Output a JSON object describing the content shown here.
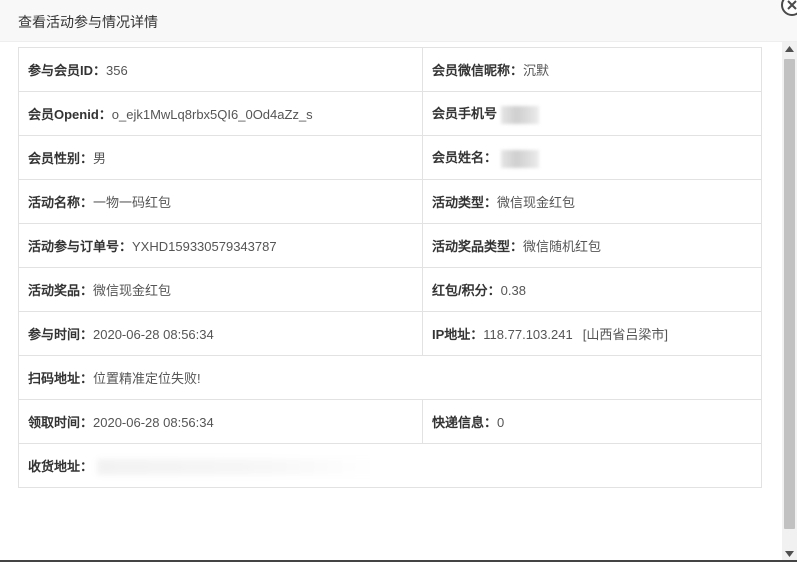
{
  "dialog": {
    "title": "查看活动参与情况详情",
    "close_icon": "close-icon"
  },
  "rows": [
    [
      {
        "label": "参与会员ID：",
        "value": "356"
      },
      {
        "label": "会员微信昵称：",
        "value": "沉默"
      }
    ],
    [
      {
        "label": "会员Openid：",
        "value": "o_ejk1MwLq8rbx5QI6_0Od4aZz_s"
      },
      {
        "label": "会员手机号",
        "value": ""
      }
    ],
    [
      {
        "label": "会员性别：",
        "value": "男"
      },
      {
        "label": "会员姓名：",
        "value": ""
      }
    ],
    [
      {
        "label": "活动名称：",
        "value": "一物一码红包"
      },
      {
        "label": "活动类型：",
        "value": "微信现金红包"
      }
    ],
    [
      {
        "label": "活动参与订单号：",
        "value": "YXHD159330579343787"
      },
      {
        "label": "活动奖品类型：",
        "value": "微信随机红包"
      }
    ],
    [
      {
        "label": "活动奖品：",
        "value": "微信现金红包"
      },
      {
        "label": "红包/积分：",
        "value": "0.38"
      }
    ],
    [
      {
        "label": "参与时间：",
        "value": "2020-06-28 08:56:34"
      },
      {
        "label": "IP地址：",
        "value": "118.77.103.241",
        "extra": "[山西省吕梁市]"
      }
    ],
    [
      {
        "label": "扫码地址：",
        "value": "位置精准定位失败!"
      }
    ],
    [
      {
        "label": "领取时间：",
        "value": "2020-06-28 08:56:34"
      },
      {
        "label": "快递信息：",
        "value": "0"
      }
    ],
    [
      {
        "label": "收货地址：",
        "value": ""
      }
    ]
  ]
}
